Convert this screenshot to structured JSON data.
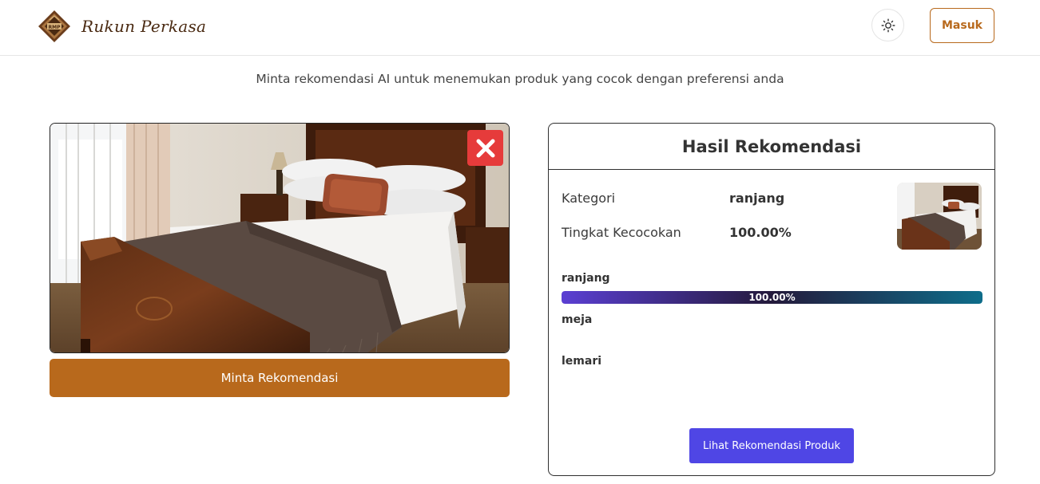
{
  "header": {
    "brand_name": "Rukun Perkasa",
    "login_label": "Masuk",
    "theme_icon": "sun-icon",
    "accent_color": "#b8691c"
  },
  "intro": {
    "subtitle": "Minta rekomendasi AI untuk menemukan produk yang cocok dengan preferensi anda"
  },
  "upload": {
    "remove_icon": "close-icon",
    "remove_color": "#e63b3b",
    "request_label": "Minta Rekomendasi"
  },
  "result": {
    "title": "Hasil Rekomendasi",
    "category_label": "Kategori",
    "category_value": "ranjang",
    "match_label": "Tingkat Kecocokan",
    "match_value": "100.00%",
    "scores": [
      {
        "label": "ranjang",
        "value": 1.0,
        "text": "100.00%"
      },
      {
        "label": "meja",
        "value": 0
      },
      {
        "label": "lemari",
        "value": 0
      }
    ],
    "view_products_label": "Lihat Rekomendasi Produk",
    "button_color": "#4f46e5"
  }
}
